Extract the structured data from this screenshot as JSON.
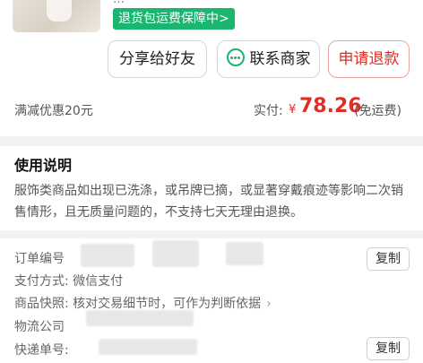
{
  "product": {
    "title_snippet": "…",
    "guarantee_badge": "退货包运费保障中>"
  },
  "actions": {
    "share_label": "分享给好友",
    "contact_label": "联系商家",
    "refund_label": "申请退款"
  },
  "payment": {
    "discount": "满减优惠20元",
    "paid_label": "实付:",
    "currency": "¥",
    "amount": "78.26",
    "freight_note": "(免运费)"
  },
  "instructions": {
    "title": "使用说明",
    "text": "服饰类商品如出现已洗涤，或吊牌已摘，或显著穿戴痕迹等影响二次销售情形，且无质量问题的，不支持七天无理由退换。"
  },
  "order": {
    "order_no_label": "订单编号",
    "pay_method_label": "支付方式:",
    "pay_method_value": "微信支付",
    "snapshot_label": "商品快照:",
    "snapshot_value": "核对交易细节时，可作为判断依据",
    "logistics_label": "物流公司",
    "tracking_label": "快递单号:",
    "copy_label": "复制"
  },
  "colors": {
    "accent_red": "#e02e24",
    "guarantee_green": "#1bb56f"
  }
}
